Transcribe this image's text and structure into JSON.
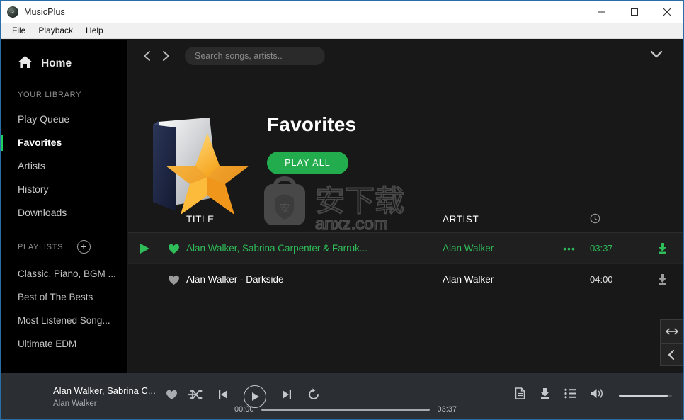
{
  "window": {
    "title": "MusicPlus",
    "app_icon": "music-note-icon",
    "minimize": "minimize-icon",
    "maximize": "maximize-icon",
    "close": "close-icon"
  },
  "menu": {
    "items": [
      "File",
      "Playback",
      "Help"
    ]
  },
  "sidebar": {
    "home": {
      "label": "Home",
      "icon": "home-icon"
    },
    "library_heading": "YOUR LIBRARY",
    "library_items": [
      {
        "label": "Play Queue",
        "active": false
      },
      {
        "label": "Favorites",
        "active": true
      },
      {
        "label": "Artists",
        "active": false
      },
      {
        "label": "History",
        "active": false
      },
      {
        "label": "Downloads",
        "active": false
      }
    ],
    "playlists_heading": "PLAYLISTS",
    "add_playlist_label": "+",
    "playlists": [
      "Classic, Piano, BGM ...",
      "Best of The Bests",
      "Most Listened Song...",
      "Ultimate EDM"
    ]
  },
  "topbar": {
    "back_icon": "chevron-left-icon",
    "forward_icon": "chevron-right-icon",
    "search_placeholder": "Search songs, artists..",
    "search_value": "",
    "expand_icon": "chevron-down-icon"
  },
  "hero": {
    "title": "Favorites",
    "play_all_label": "PLAY ALL",
    "cover_icon": "favorites-folder-star-icon"
  },
  "watermark": {
    "text": "anxz.com"
  },
  "tracklist": {
    "columns": {
      "title": "TITLE",
      "artist": "ARTIST",
      "duration": "clock-icon"
    },
    "rows": [
      {
        "title": "Alan Walker, Sabrina Carpenter & Farruk...",
        "artist": "Alan Walker",
        "duration": "03:37",
        "playing": true,
        "favorited": true,
        "more_label": "•••"
      },
      {
        "title": "Alan Walker - Darkside",
        "artist": "Alan Walker",
        "duration": "04:00",
        "playing": false,
        "favorited": true,
        "more_label": ""
      }
    ]
  },
  "side_buttons": [
    {
      "icon": "resize-horizontal-icon"
    },
    {
      "icon": "collapse-left-icon"
    }
  ],
  "player": {
    "now_playing_title": "Alan Walker, Sabrina C...",
    "now_playing_artist": "Alan Walker",
    "favorite_icon": "heart-icon",
    "add_icon": "plus-icon",
    "shuffle_icon": "shuffle-icon",
    "previous_icon": "previous-icon",
    "play_icon": "play-icon",
    "next_icon": "next-icon",
    "repeat_icon": "repeat-icon",
    "elapsed": "00:00",
    "total": "03:37",
    "progress_percent": 0,
    "lyrics_icon": "lyrics-icon",
    "download_icon": "download-icon",
    "queue_icon": "queue-list-icon",
    "volume_icon": "volume-icon",
    "volume_percent": 92
  },
  "colors": {
    "accent_green": "#1ed05e",
    "play_all_green": "#23ac4d",
    "sidebar_bg": "#000000",
    "main_bg": "#181818",
    "player_bg": "#2b2f33"
  }
}
